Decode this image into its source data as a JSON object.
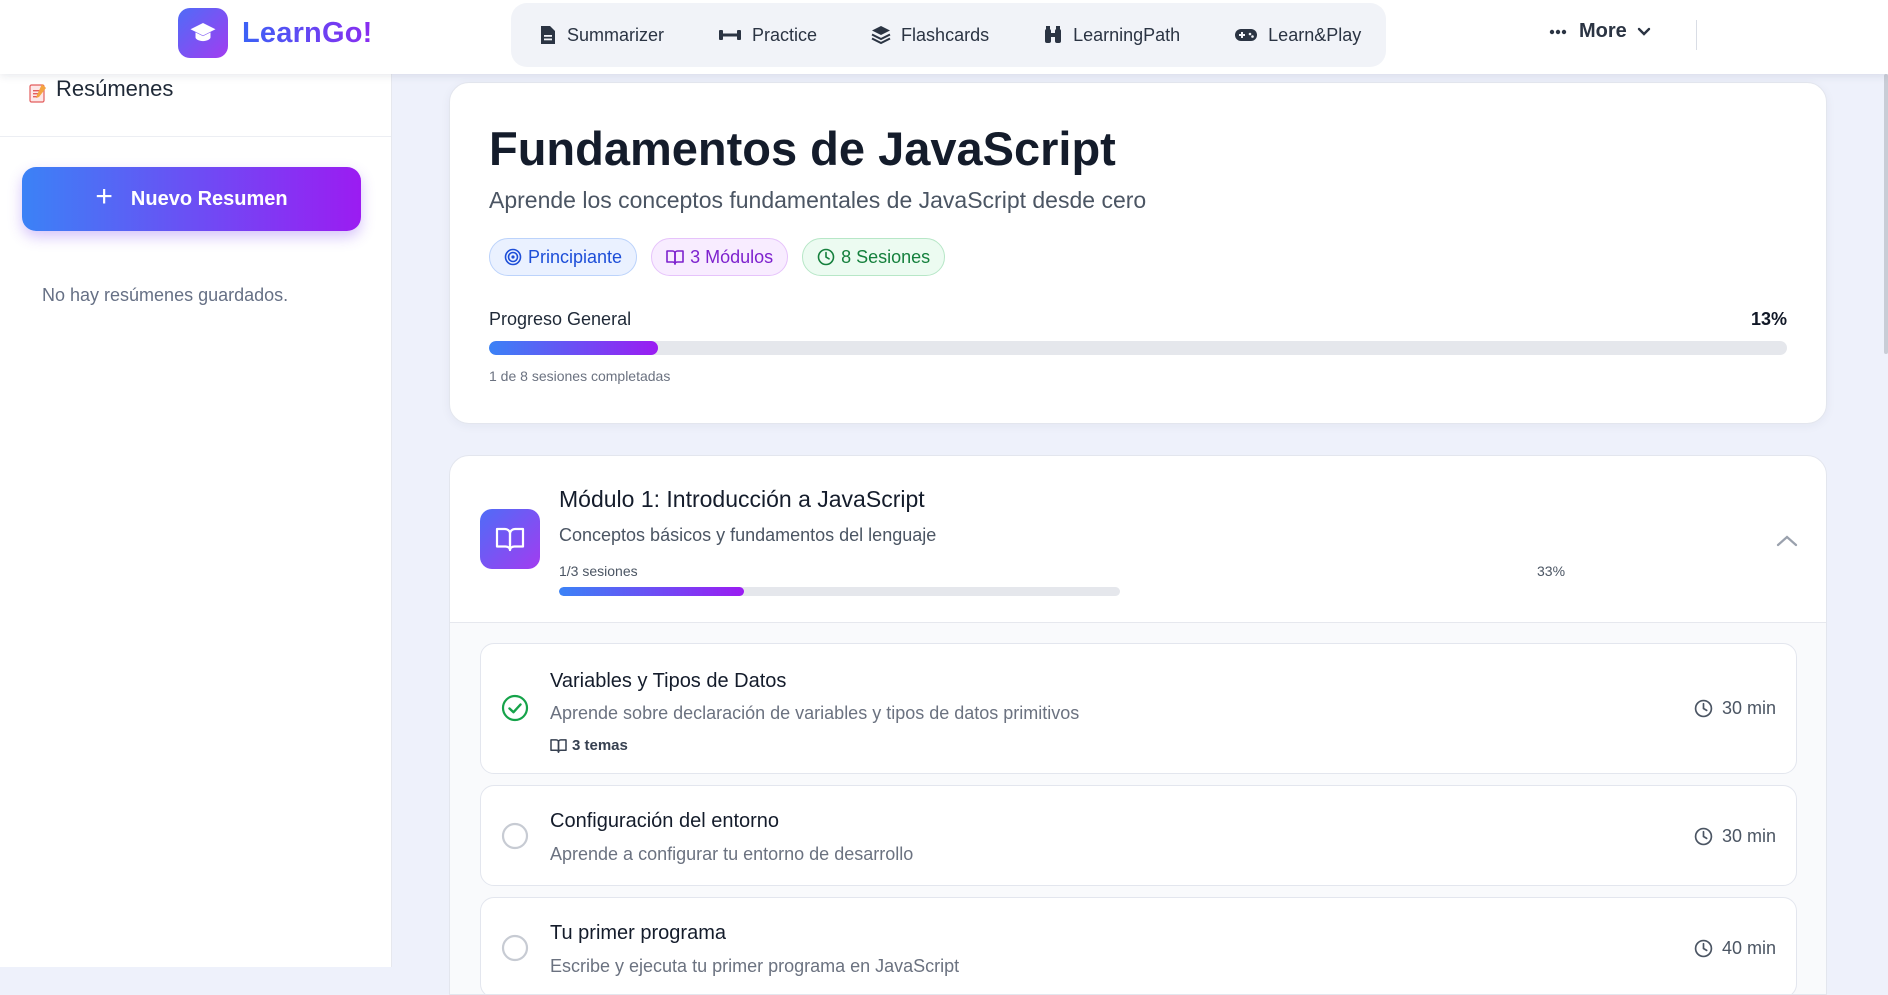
{
  "brand": {
    "name": "LearnGo!"
  },
  "nav": {
    "items": [
      {
        "label": "Summarizer",
        "icon": "document-icon"
      },
      {
        "label": "Practice",
        "icon": "dumbbell-icon"
      },
      {
        "label": "Flashcards",
        "icon": "layers-icon"
      },
      {
        "label": "LearningPath",
        "icon": "binoculars-icon"
      },
      {
        "label": "Learn&Play",
        "icon": "gamepad-icon"
      }
    ],
    "more_label": "More"
  },
  "sidebar": {
    "title": "Resúmenes",
    "new_button_label": "Nuevo Resumen",
    "empty_message": "No hay resúmenes guardados."
  },
  "course": {
    "title": "Fundamentos de JavaScript",
    "subtitle": "Aprende los conceptos fundamentales de JavaScript desde cero",
    "tags": {
      "level": "Principiante",
      "modules": "3 Módulos",
      "sessions": "8 Sesiones"
    },
    "progress_label": "Progreso General",
    "progress_percent": "13%",
    "progress_fraction": 0.13,
    "progress_note": "1 de 8 sesiones completadas"
  },
  "module": {
    "title": "Módulo 1: Introducción a JavaScript",
    "subtitle": "Conceptos básicos y fundamentos del lenguaje",
    "sessions_count": "1/3 sesiones",
    "percent": "33%",
    "progress_fraction": 0.33,
    "sessions": [
      {
        "title": "Variables y Tipos de Datos",
        "description": "Aprende sobre declaración de variables y tipos de datos primitivos",
        "topics": "3 temas",
        "duration": "30 min",
        "completed": true
      },
      {
        "title": "Configuración del entorno",
        "description": "Aprende a configurar tu entorno de desarrollo",
        "duration": "30 min",
        "completed": false
      },
      {
        "title": "Tu primer programa",
        "description": "Escribe y ejecuta tu primer programa en JavaScript",
        "duration": "40 min",
        "completed": false
      }
    ]
  },
  "colors": {
    "accent_start": "#3b82f6",
    "accent_end": "#9b1cf2",
    "success": "#16a34a"
  }
}
